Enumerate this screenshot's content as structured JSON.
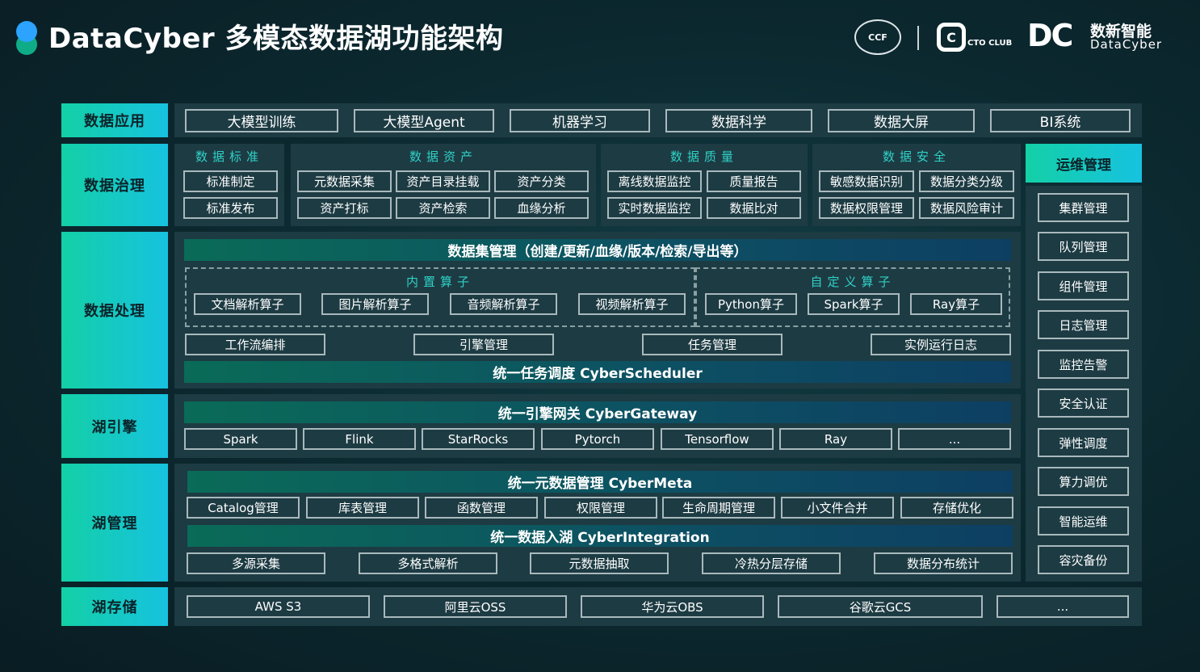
{
  "header": {
    "title": "DataCyber 多模态数据湖功能架构",
    "ccf_logo": "CCF",
    "cto_logo_letter": "C",
    "cto_logo_text": "CTO CLUB",
    "dc_logo": "DC",
    "dc_cn": "数新智能",
    "dc_en": "DataCyber"
  },
  "rows": {
    "app": {
      "label": "数据应用",
      "items": [
        "大模型训练",
        "大模型Agent",
        "机器学习",
        "数据科学",
        "数据大屏",
        "BI系统"
      ]
    },
    "gov": {
      "label": "数据治理",
      "groups": [
        {
          "title": "数据标准",
          "items": [
            "标准制定",
            "标准发布"
          ]
        },
        {
          "title": "数据资产",
          "items": [
            "元数据采集",
            "资产目录挂载",
            "资产分类",
            "资产打标",
            "资产检索",
            "血缘分析"
          ]
        },
        {
          "title": "数据质量",
          "items": [
            "离线数据监控",
            "质量报告",
            "实时数据监控",
            "数据比对"
          ]
        },
        {
          "title": "数据安全",
          "items": [
            "敏感数据识别",
            "数据分类分级",
            "数据权限管理",
            "数据风险审计"
          ]
        }
      ]
    },
    "proc": {
      "label": "数据处理",
      "dataset_bar": "数据集管理（创建/更新/血缘/版本/检索/导出等）",
      "builtin_title": "内置算子",
      "builtin": [
        "文档解析算子",
        "图片解析算子",
        "音频解析算子",
        "视频解析算子"
      ],
      "custom_title": "自定义算子",
      "custom": [
        "Python算子",
        "Spark算子",
        "Ray算子"
      ],
      "tools": [
        "工作流编排",
        "引擎管理",
        "任务管理",
        "实例运行日志"
      ],
      "scheduler_bar": "统一任务调度 CyberScheduler"
    },
    "engine": {
      "label": "湖引擎",
      "gateway_bar": "统一引擎网关 CyberGateway",
      "items": [
        "Spark",
        "Flink",
        "StarRocks",
        "Pytorch",
        "Tensorflow",
        "Ray",
        "..."
      ]
    },
    "mgmt": {
      "label": "湖管理",
      "meta_bar": "统一元数据管理 CyberMeta",
      "meta_items": [
        "Catalog管理",
        "库表管理",
        "函数管理",
        "权限管理",
        "生命周期管理",
        "小文件合并",
        "存储优化"
      ],
      "integ_bar": "统一数据入湖 CyberIntegration",
      "integ_items": [
        "多源采集",
        "多格式解析",
        "元数据抽取",
        "冷热分层存储",
        "数据分布统计"
      ]
    },
    "storage": {
      "label": "湖存储",
      "items": [
        "AWS S3",
        "阿里云OSS",
        "华为云OBS",
        "谷歌云GCS",
        "..."
      ]
    }
  },
  "ops": {
    "title": "运维管理",
    "items": [
      "集群管理",
      "队列管理",
      "组件管理",
      "日志管理",
      "监控告警",
      "安全认证",
      "弹性调度",
      "算力调优",
      "智能运维",
      "容灾备份"
    ]
  },
  "colors": {
    "accent_start": "#13d0a6",
    "accent_end": "#17c2e0",
    "panel": "#1d3b43",
    "header_text": "#2fd1c6"
  }
}
